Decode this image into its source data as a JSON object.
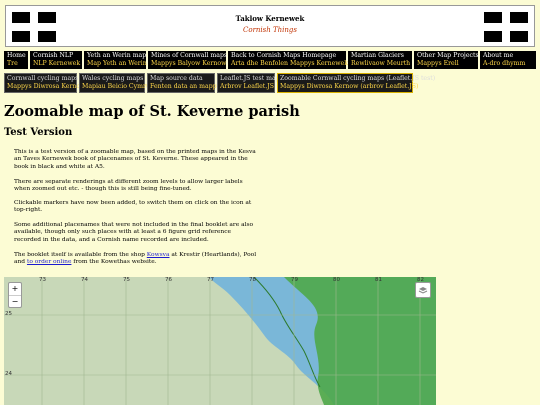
{
  "header": {
    "title": "Taklow Kernewek",
    "subtitle": "Cornish Things"
  },
  "nav_top": [
    {
      "en": "Home",
      "kw": "Tre"
    },
    {
      "en": "Cornish NLP",
      "kw": "NLP Kernewek"
    },
    {
      "en": "Yeth an Werin map",
      "kw": "Map Yeth an Werin"
    },
    {
      "en": "Mines of Cornwall maps",
      "kw": "Mappys Balyow Kernow"
    },
    {
      "en": "Back to Cornish Maps Homepage",
      "kw": "Arta dhe Benfolen Mappys Kernewek"
    },
    {
      "en": "Martian Glaciers",
      "kw": "Rewlivaow Meurth"
    },
    {
      "en": "Other Map Projects",
      "kw": "Mappys Erell"
    },
    {
      "en": "About me",
      "kw": "A-dro dhymm"
    }
  ],
  "nav_sub": [
    {
      "en": "Cornwall cycling maps",
      "kw": "Mappys Diwrosa Kernow"
    },
    {
      "en": "Wales cycling maps",
      "kw": "Mapiau Beicio Cymru"
    },
    {
      "en": "Map source data",
      "kw": "Fenten data an mappys"
    },
    {
      "en": "Leaflet.JS test maps",
      "kw": "Arbrov Leaflet.JS"
    },
    {
      "en": "Zoomable Cornwall cycling maps (Leaflet.JS test)",
      "kw": "Mappys Diwrosa Kernow (arbrov Leaflet.JS)"
    }
  ],
  "page": {
    "title": "Zoomable map of St. Keverne parish",
    "subtitle": "Test Version",
    "p1": "This is a test version of a zoomable map, based on the printed maps in the Kesva an Taves Kernewek book of placenames of St. Keverne. These appeared in the book in black and white at A5.",
    "p2": "There are separate renderings at different zoom levels to allow larger labels when zoomed out etc. - though this is still being fine-tuned.",
    "p3": "Clickable markers have now been added, to switch them on click on the icon at top-right.",
    "p4": "Some additional placenames that were not included in the final booklet are also available, though only such places with at least a 6 figure grid reference recorded in the data, and a Cornish name recorded are included.",
    "p5_a": "The booklet itself is available from the shop ",
    "p5_link1": "Kowsva",
    "p5_b": " at Krestir (Heartlands), Pool and ",
    "p5_link2": "to order online",
    "p5_c": " from the Kowethas website."
  },
  "map": {
    "zoom_in": "+",
    "zoom_out": "−",
    "grid_x": [
      "73",
      "74",
      "75",
      "76",
      "77",
      "78",
      "79",
      "80",
      "81",
      "82"
    ],
    "grid_y": [
      "25",
      "24"
    ],
    "sea_color": "#7ab7d8",
    "land_color": "#c8d8b8",
    "high_color": "#4fa84a"
  }
}
